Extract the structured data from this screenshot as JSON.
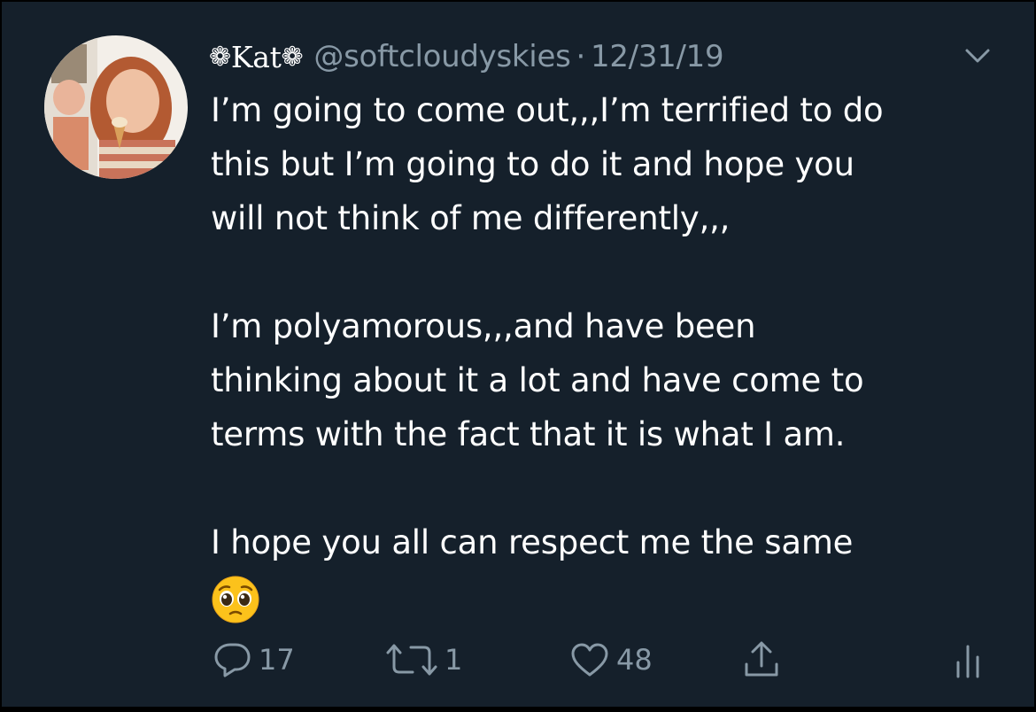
{
  "tweet": {
    "display_name": "Kat",
    "name_decoration_left": "❁",
    "name_decoration_right": "❁",
    "handle": "@softcloudyskies",
    "separator": "·",
    "date": "12/31/19",
    "body": {
      "line1": "I’m going to come out,,,I’m terrified to do",
      "line2": "this but I’m going to do it and hope you",
      "line3": "will not think of me differently,,,",
      "line4": "I’m polyamorous,,,and have been",
      "line5": "thinking about it a lot and have come to",
      "line6": "terms with the fact that it is what I am.",
      "line7": "I hope you all can respect me the same"
    },
    "emoji": "pleading-face",
    "counts": {
      "replies": "17",
      "retweets": "1",
      "likes": "48"
    }
  },
  "icons": {
    "reply": "reply-icon",
    "retweet": "retweet-icon",
    "like": "heart-icon",
    "share": "share-icon",
    "analytics": "analytics-icon",
    "menu": "chevron-down-icon"
  },
  "colors": {
    "background": "#15202b",
    "text": "#ffffff",
    "secondary": "#8899a6"
  }
}
